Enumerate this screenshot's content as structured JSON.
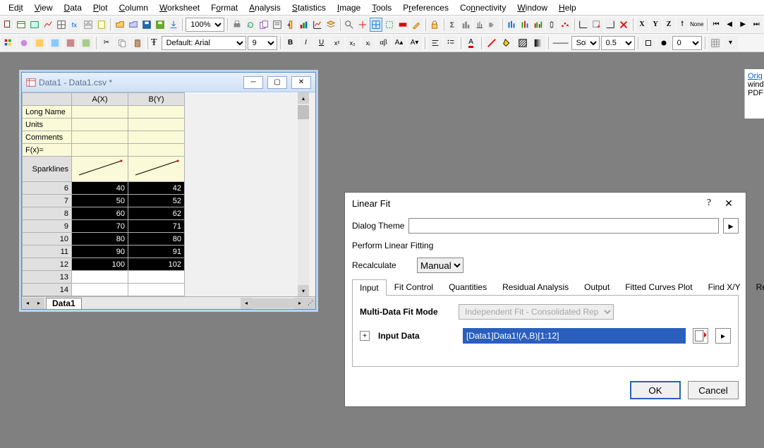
{
  "menu": {
    "items": [
      "Edit",
      "View",
      "Data",
      "Plot",
      "Column",
      "Worksheet",
      "Format",
      "Analysis",
      "Statistics",
      "Image",
      "Tools",
      "Preferences",
      "Connectivity",
      "Window",
      "Help"
    ],
    "accel": [
      "i",
      "V",
      "D",
      "P",
      "C",
      "W",
      "o",
      "A",
      "S",
      "I",
      "T",
      "r",
      "n",
      "W",
      "H"
    ]
  },
  "toolbar1": {
    "zoom": "100%"
  },
  "toolbar2": {
    "font_label": "Default: Arial",
    "font": "Default: Arial",
    "size": "9",
    "bold": "B",
    "italic": "I",
    "underline": "U",
    "style_combo": "Sol",
    "width_val": "0.5",
    "num_val": "0"
  },
  "worksheet": {
    "title": "Data1 - Data1.csv *",
    "cols": [
      "A(X)",
      "B(Y)"
    ],
    "rowheads": [
      "Long Name",
      "Units",
      "Comments",
      "F(x)=",
      "Sparklines"
    ],
    "rows": [
      {
        "n": "6",
        "a": "40",
        "b": "42",
        "sel": true
      },
      {
        "n": "7",
        "a": "50",
        "b": "52",
        "sel": true
      },
      {
        "n": "8",
        "a": "60",
        "b": "62",
        "sel": true
      },
      {
        "n": "9",
        "a": "70",
        "b": "71",
        "sel": true
      },
      {
        "n": "10",
        "a": "80",
        "b": "80",
        "sel": true
      },
      {
        "n": "11",
        "a": "90",
        "b": "91",
        "sel": true
      },
      {
        "n": "12",
        "a": "100",
        "b": "102",
        "sel": true
      },
      {
        "n": "13",
        "a": "",
        "b": "",
        "sel": false
      },
      {
        "n": "14",
        "a": "",
        "b": "",
        "sel": false
      }
    ],
    "tab": "Data1"
  },
  "dialog": {
    "title": "Linear Fit",
    "theme_label": "Dialog Theme",
    "theme_value": "",
    "desc": "Perform Linear Fitting",
    "recalc_label": "Recalculate",
    "recalc_value": "Manual",
    "tabs": [
      "Input",
      "Fit Control",
      "Quantities",
      "Residual Analysis",
      "Output",
      "Fitted Curves Plot",
      "Find X/Y",
      "Residual Plots"
    ],
    "active_tab": 0,
    "mdfm_label": "Multi-Data Fit Mode",
    "mdfm_value": "Independent Fit - Consolidated Report",
    "idata_label": "Input Data",
    "idata_value": "[Data1]Data1!(A,B)[1:12]",
    "ok": "OK",
    "cancel": "Cancel"
  },
  "sidetip": {
    "link": "Orig",
    "l2": "wind",
    "l3": "PDF"
  },
  "chart_data": {
    "type": "line",
    "series": [
      {
        "name": "A(X)",
        "values": [
          40,
          50,
          60,
          70,
          80,
          90,
          100
        ]
      },
      {
        "name": "B(Y)",
        "values": [
          42,
          52,
          62,
          71,
          80,
          91,
          102
        ]
      }
    ],
    "categories": [
      6,
      7,
      8,
      9,
      10,
      11,
      12
    ],
    "title": "Sparklines"
  }
}
